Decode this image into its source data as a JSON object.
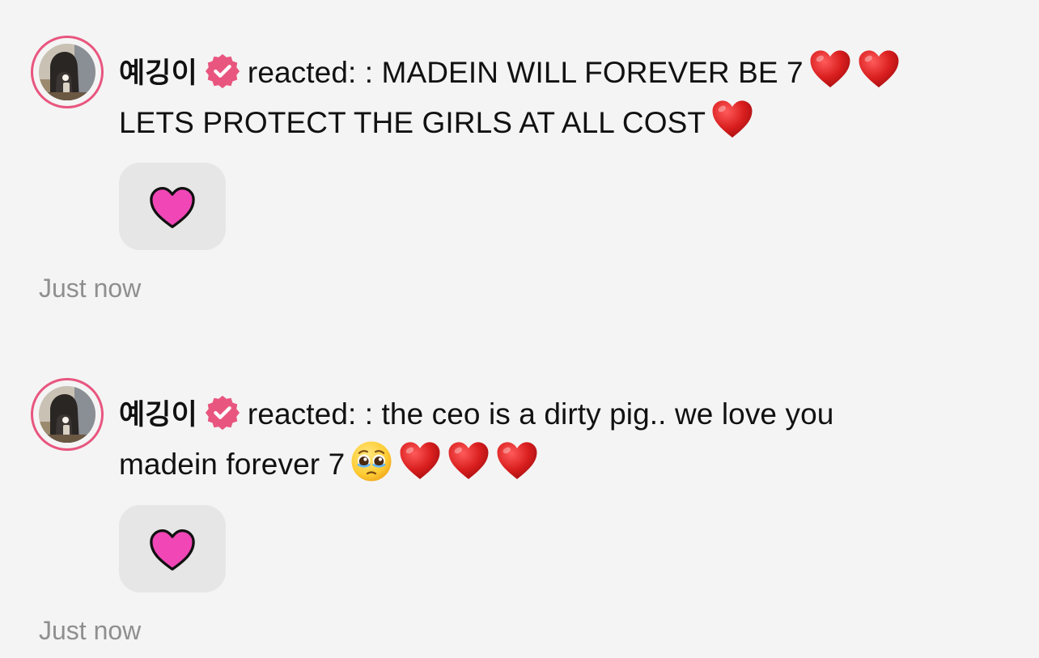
{
  "colors": {
    "background": "#f4f4f4",
    "avatar_ring": "#e8567f",
    "verified_badge": "#e8567f",
    "reaction_box": "#e6e6e6",
    "reaction_heart": "#f146b6",
    "timestamp": "#8f8f8f"
  },
  "notifications": [
    {
      "username": "예깅이",
      "verified_icon": "verified-badge-icon",
      "action": "reacted: : MADEIN WILL FOREVER BE 7",
      "message_line2": "LETS PROTECT THE GIRLS AT ALL COST",
      "inline_emojis": [
        "red-heart",
        "red-heart",
        "red-heart"
      ],
      "reaction": "pink-heart",
      "time": "Just now"
    },
    {
      "username": "예깅이",
      "verified_icon": "verified-badge-icon",
      "action": "reacted: : the ceo is a dirty pig.. we love you",
      "message_line2": "madein forever 7",
      "inline_emojis": [
        "pleading-face",
        "red-heart",
        "red-heart",
        "red-heart"
      ],
      "reaction": "pink-heart",
      "time": "Just now"
    }
  ]
}
